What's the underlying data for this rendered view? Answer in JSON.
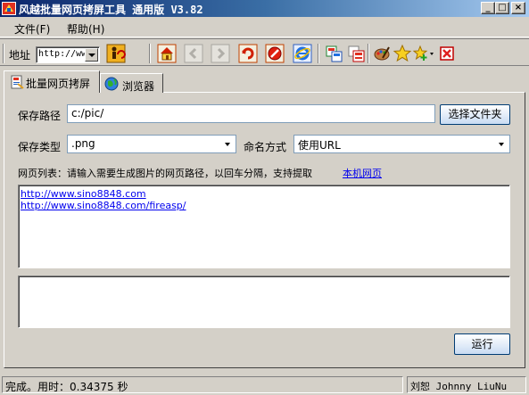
{
  "window": {
    "title": "风越批量网页拷屏工具 通用版 V3.82",
    "controls": [
      "_",
      "□",
      "×"
    ]
  },
  "menu": {
    "items": [
      "文件(F)",
      "帮助(H)"
    ]
  },
  "toolbar": {
    "address_label": "地址",
    "address_value": "http://ww",
    "buttons": [
      "run-icon",
      "home-icon",
      "back-icon",
      "forward-icon",
      "refresh-icon",
      "stop-icon",
      "ie-icon",
      "copy-icon",
      "paste-icon",
      "palette-icon",
      "star-icon",
      "add-favorite-icon",
      "close-icon"
    ]
  },
  "tabs": [
    {
      "label": "批量网页拷屏",
      "icon": "document-icon",
      "active": true
    },
    {
      "label": "浏览器",
      "icon": "globe-icon",
      "active": false
    }
  ],
  "form": {
    "save_path_label": "保存路径",
    "save_path_value": "c:/pic/",
    "choose_folder_button": "选择文件夹",
    "save_type_label": "保存类型",
    "save_type_value": ".png",
    "naming_label": "命名方式",
    "naming_value": "使用URL",
    "url_list_hint": "网页列表：请输入需要生成图片的网页路径，以回车分隔，支持提取",
    "local_page_link": "本机网页",
    "urls": [
      "http://www.sino8848.com",
      "http://www.sino8848.com/fireasp/"
    ],
    "log": "",
    "run_button": "运行"
  },
  "status": {
    "message": "完成。用时：0.34375 秒",
    "author": "刘恕 Johnny LiuNu"
  },
  "colors": {
    "title_start": "#0a246a",
    "title_end": "#a6caf0",
    "face": "#d4d0c8",
    "link": "#0000ee",
    "xp_border": "#003c74"
  }
}
